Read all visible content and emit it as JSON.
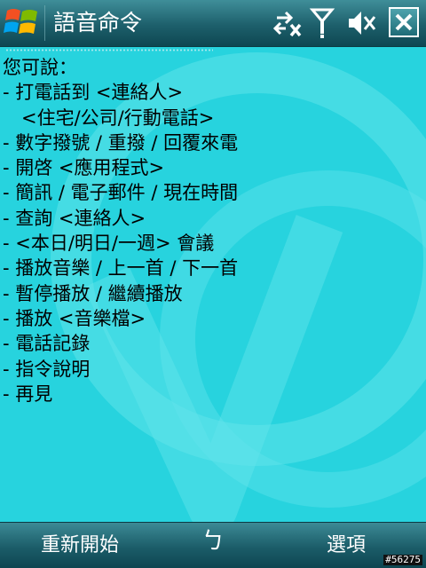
{
  "title_bar": {
    "title": "語音命令",
    "icons": [
      "windows-start-icon",
      "connectivity-icon",
      "signal-icon",
      "speaker-muted-icon",
      "close-icon"
    ]
  },
  "content": {
    "intro": "您可說：",
    "lines": [
      {
        "kind": "item",
        "text": "- 打電話到 <連絡人>"
      },
      {
        "kind": "sub",
        "text": "<住宅/公司/行動電話>"
      },
      {
        "kind": "item",
        "text": "- 數字撥號 / 重撥 / 回覆來電"
      },
      {
        "kind": "item",
        "text": "- 開啓 <應用程式>"
      },
      {
        "kind": "item",
        "text": "- 簡訊 / 電子郵件 / 現在時間"
      },
      {
        "kind": "item",
        "text": "- 查詢 <連絡人>"
      },
      {
        "kind": "item",
        "text": "- <本日/明日/一週> 會議"
      },
      {
        "kind": "item",
        "text": "- 播放音樂 / 上一首 / 下一首"
      },
      {
        "kind": "item",
        "text": "- 暫停播放 / 繼續播放"
      },
      {
        "kind": "item",
        "text": "- 播放 <音樂檔>"
      },
      {
        "kind": "item",
        "text": "- 電話記錄"
      },
      {
        "kind": "item",
        "text": "- 指令說明"
      },
      {
        "kind": "item",
        "text": "- 再見"
      }
    ]
  },
  "menu_bar": {
    "left_softkey": "重新開始",
    "sip_label": "ㄅ",
    "right_softkey": "選項"
  },
  "watermark": "#56275",
  "colors": {
    "background": "#27d3de",
    "bar_dark": "#1d5f6b",
    "text": "#000000",
    "bar_text": "#ffffff"
  }
}
